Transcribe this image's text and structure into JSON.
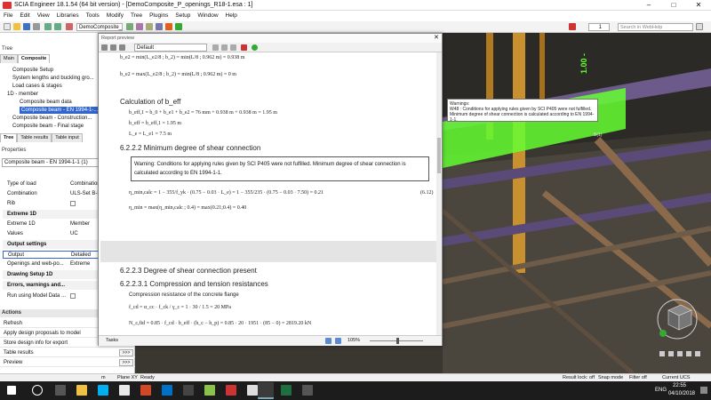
{
  "window": {
    "title": "SCIA Engineer 18.1.54 (64 bit version) - [DemoComposite_P_openings_R18-1.esa : 1]"
  },
  "menu": [
    "File",
    "Edit",
    "View",
    "Libraries",
    "Tools",
    "Modify",
    "Tree",
    "Plugins",
    "Setup",
    "Window",
    "Help"
  ],
  "toolbar": {
    "project_selector": "DemoComposite_P",
    "spin1": "1",
    "spin2": "0.5",
    "search_placeholder": "Search in WebHelp"
  },
  "left_panel": {
    "tree_label": "Tree",
    "tabs": [
      "Main",
      "Composite"
    ],
    "tree_items": [
      "Composite Setup",
      "System lengths and buckling gro...",
      "Load cases & stages",
      "1D - member",
      "Composite beam data",
      "Composite beam - EN 1994-1-...",
      "Composite beam - Construction...",
      "Composite beam - Final stage"
    ],
    "bottom_tabs": [
      "Tree",
      "Table results",
      "Table input"
    ],
    "properties_label": "Properties",
    "properties_selector": "Composite beam - EN 1994-1-1 (1)",
    "properties": {
      "type_of_load": {
        "label": "Type of load",
        "value": "Combination"
      },
      "combination": {
        "label": "Combination",
        "value": "ULS-Set B-P"
      },
      "rib": {
        "label": "Rib",
        "value": ""
      },
      "extreme_group": "Extreme 1D",
      "extreme": {
        "label": "Extreme 1D",
        "value": "Member"
      },
      "values": {
        "label": "Values",
        "value": "UC"
      },
      "output_group": "Output settings",
      "output": {
        "label": "Output",
        "value": "Detailed"
      },
      "openings": {
        "label": "Openings and web-po...",
        "value": "Extreme"
      },
      "drawing_group": "Drawing Setup 1D",
      "errors_group": "Errors, warnings and...",
      "run_label": "Run using Model Data ..."
    },
    "actions_label": "Actions",
    "actions": [
      {
        "label": "Refresh",
        "arrow": ""
      },
      {
        "label": "Apply design proposals to model",
        "arrow": ""
      },
      {
        "label": "Store design info for export",
        "arrow": ""
      },
      {
        "label": "Table results",
        "arrow": ">>>"
      },
      {
        "label": "Preview",
        "arrow": ">>>"
      }
    ]
  },
  "report": {
    "title": "Report preview",
    "view_selector": "Default",
    "eq_top1": "b_e2 = min(L_e2/8 ; b_2) = min(L/8 ; 0.962 m) = 0.938 m",
    "eq_top2": "b_e2 = max(L_e2/8 ; b_2) = min(L/8 ; 0.962 m) = 0 m",
    "calc_beff": "Calculation of b_eff",
    "eq_beff1": "b_eff,1 = b_0 + b_e1 + b_e2 = 76 mm + 0.938 m + 0.938 m = 1.95 m",
    "eq_beff2": "b_eff = b_eff,1 = 1.95 m",
    "eq_le": "L_e = L_e1 = 7.5 m",
    "h_6222": "6.2.2.2 Minimum degree of shear connection",
    "warning": "Warning: Conditions for applying rules given by SCI P405 were not fulfilled. Minimum degree of shear connection is calculated according to EN 1994-1-1.",
    "eq_eta1": "η_min,calc = 1 − 355/f_yk · (0.75 − 0.03 · L_e) = 1 − 355/235 · (0.75 − 0.03 · 7.50) = 0.21",
    "eq_ref": "(6.12)",
    "eq_eta2": "η_min = max(η_min,calc ; 0.4) = max(0.21;0.4) = 0.40",
    "h_6223": "6.2.2.3 Degree of shear connection present",
    "h_62231": "6.2.2.3.1 Compression and tension resistances",
    "comp_text": "Compression resistance of the concrete flange",
    "eq_fcd": "f_cd = α_cc · f_ck / γ_c = 1 · 30 / 1.5 = 20 MPa",
    "eq_ncmax": "N_c,fid = 0.85 · f_cd · b_eff · (h_c − h_p) = 0.85 · 20 · 1951 · (85 − 0) = 2819.20 kN",
    "status_tasks": "Tasks",
    "zoom": "105%"
  },
  "view3d": {
    "tooltip_title": "Warnings:",
    "tooltip_text": "W48 : Conditions for applying rules given by SCI P405 were not fulfilled. Minimum degree of shear connection is calculated according to EN 1994-1-1.",
    "uc_label": "1.00 -",
    "beam_label": "B(1)"
  },
  "statusbar": {
    "unit": "m",
    "plane": "Plane XY",
    "ready": "Ready",
    "result_lock": "Result lock: off",
    "snap": "Snap mode",
    "filter": "Filter off",
    "ucs": "Current UCS"
  },
  "taskbar": {
    "lang": "ENG",
    "time": "22:55",
    "date": "04/10/2018"
  },
  "colors": {
    "accent": "#3366cc",
    "uc_green": "#66ff33",
    "view_bg": "#2c2a26",
    "taskbar": "#1c1c1c"
  }
}
